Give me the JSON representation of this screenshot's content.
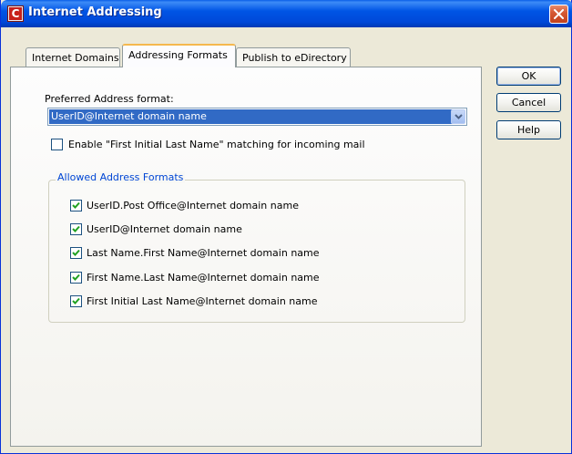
{
  "window": {
    "title": "Internet Addressing",
    "app_icon_letter": "C"
  },
  "tabs": [
    {
      "label": "Internet Domains",
      "active": false
    },
    {
      "label": "Addressing Formats",
      "active": true
    },
    {
      "label": "Publish to eDirectory",
      "active": false
    }
  ],
  "preferred": {
    "label": "Preferred Address format:",
    "selected_value": "UserID@Internet domain name"
  },
  "matching": {
    "label": "Enable \"First Initial Last Name\" matching for incoming mail",
    "checked": false
  },
  "allowed_formats": {
    "title": "Allowed Address Formats",
    "items": [
      {
        "label": "UserID.Post Office@Internet domain name",
        "checked": true
      },
      {
        "label": "UserID@Internet domain name",
        "checked": true
      },
      {
        "label": "Last Name.First Name@Internet domain name",
        "checked": true
      },
      {
        "label": "First Name.Last Name@Internet domain name",
        "checked": true
      },
      {
        "label": "First Initial Last Name@Internet domain name",
        "checked": true
      }
    ]
  },
  "buttons": {
    "ok": "OK",
    "cancel": "Cancel",
    "help": "Help"
  },
  "colors": {
    "title_bar": "#0055E5",
    "selection": "#316AC5",
    "group_title": "#0046D5",
    "check": "#21A121"
  }
}
